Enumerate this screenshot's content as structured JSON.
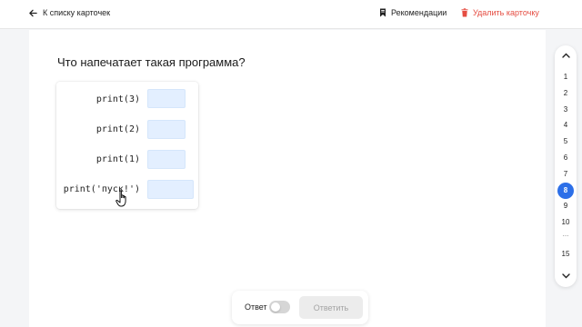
{
  "header": {
    "back_label": "К списку карточек",
    "recommendations_label": "Рекомендации",
    "delete_label": "Удалить карточку"
  },
  "task": {
    "question": "Что напечатает такая программа?",
    "lines": [
      {
        "code": "print(3)",
        "answer": ""
      },
      {
        "code": "print(2)",
        "answer": ""
      },
      {
        "code": "print(1)",
        "answer": ""
      },
      {
        "code": "print('пуск!')",
        "answer": ""
      }
    ]
  },
  "bottom_bar": {
    "answer_toggle_label": "Ответ",
    "toggle_on": false,
    "submit_label": "Ответить"
  },
  "pager": {
    "pages": [
      "1",
      "2",
      "3",
      "4",
      "5",
      "6",
      "7",
      "8",
      "9",
      "10"
    ],
    "active_page": "8",
    "ellipsis": "...",
    "last_page": "15"
  },
  "colors": {
    "accent": "#2c6fe8",
    "danger": "#e54d42",
    "answer_field": "#e3efff"
  },
  "icons": [
    "arrow-left-icon",
    "bookmark-icon",
    "trash-icon",
    "chevron-up-icon",
    "chevron-down-icon",
    "hand-pointer-icon"
  ]
}
